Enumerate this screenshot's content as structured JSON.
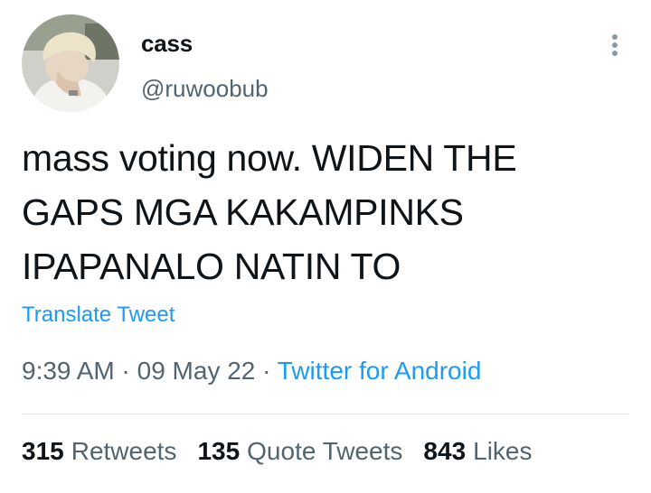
{
  "user": {
    "display_name": "cass",
    "handle": "@ruwoobub"
  },
  "tweet": {
    "text": "mass voting now. WIDEN THE\nGAPS MGA KAKAMPINKS\nIPAPANALO NATIN TO",
    "translate_label": "Translate Tweet",
    "time": "9:39 AM",
    "separator": "·",
    "date": "09 May 22",
    "source": "Twitter for Android"
  },
  "stats": {
    "retweets": {
      "count": "315",
      "label": "Retweets"
    },
    "quote_tweets": {
      "count": "135",
      "label": "Quote Tweets"
    },
    "likes": {
      "count": "843",
      "label": "Likes"
    }
  },
  "icons": {
    "more": "more-vertical-icon"
  },
  "colors": {
    "link": "#1d9bf0",
    "secondary": "#536471",
    "primary": "#0f1419",
    "divider": "#e4e8eb"
  }
}
